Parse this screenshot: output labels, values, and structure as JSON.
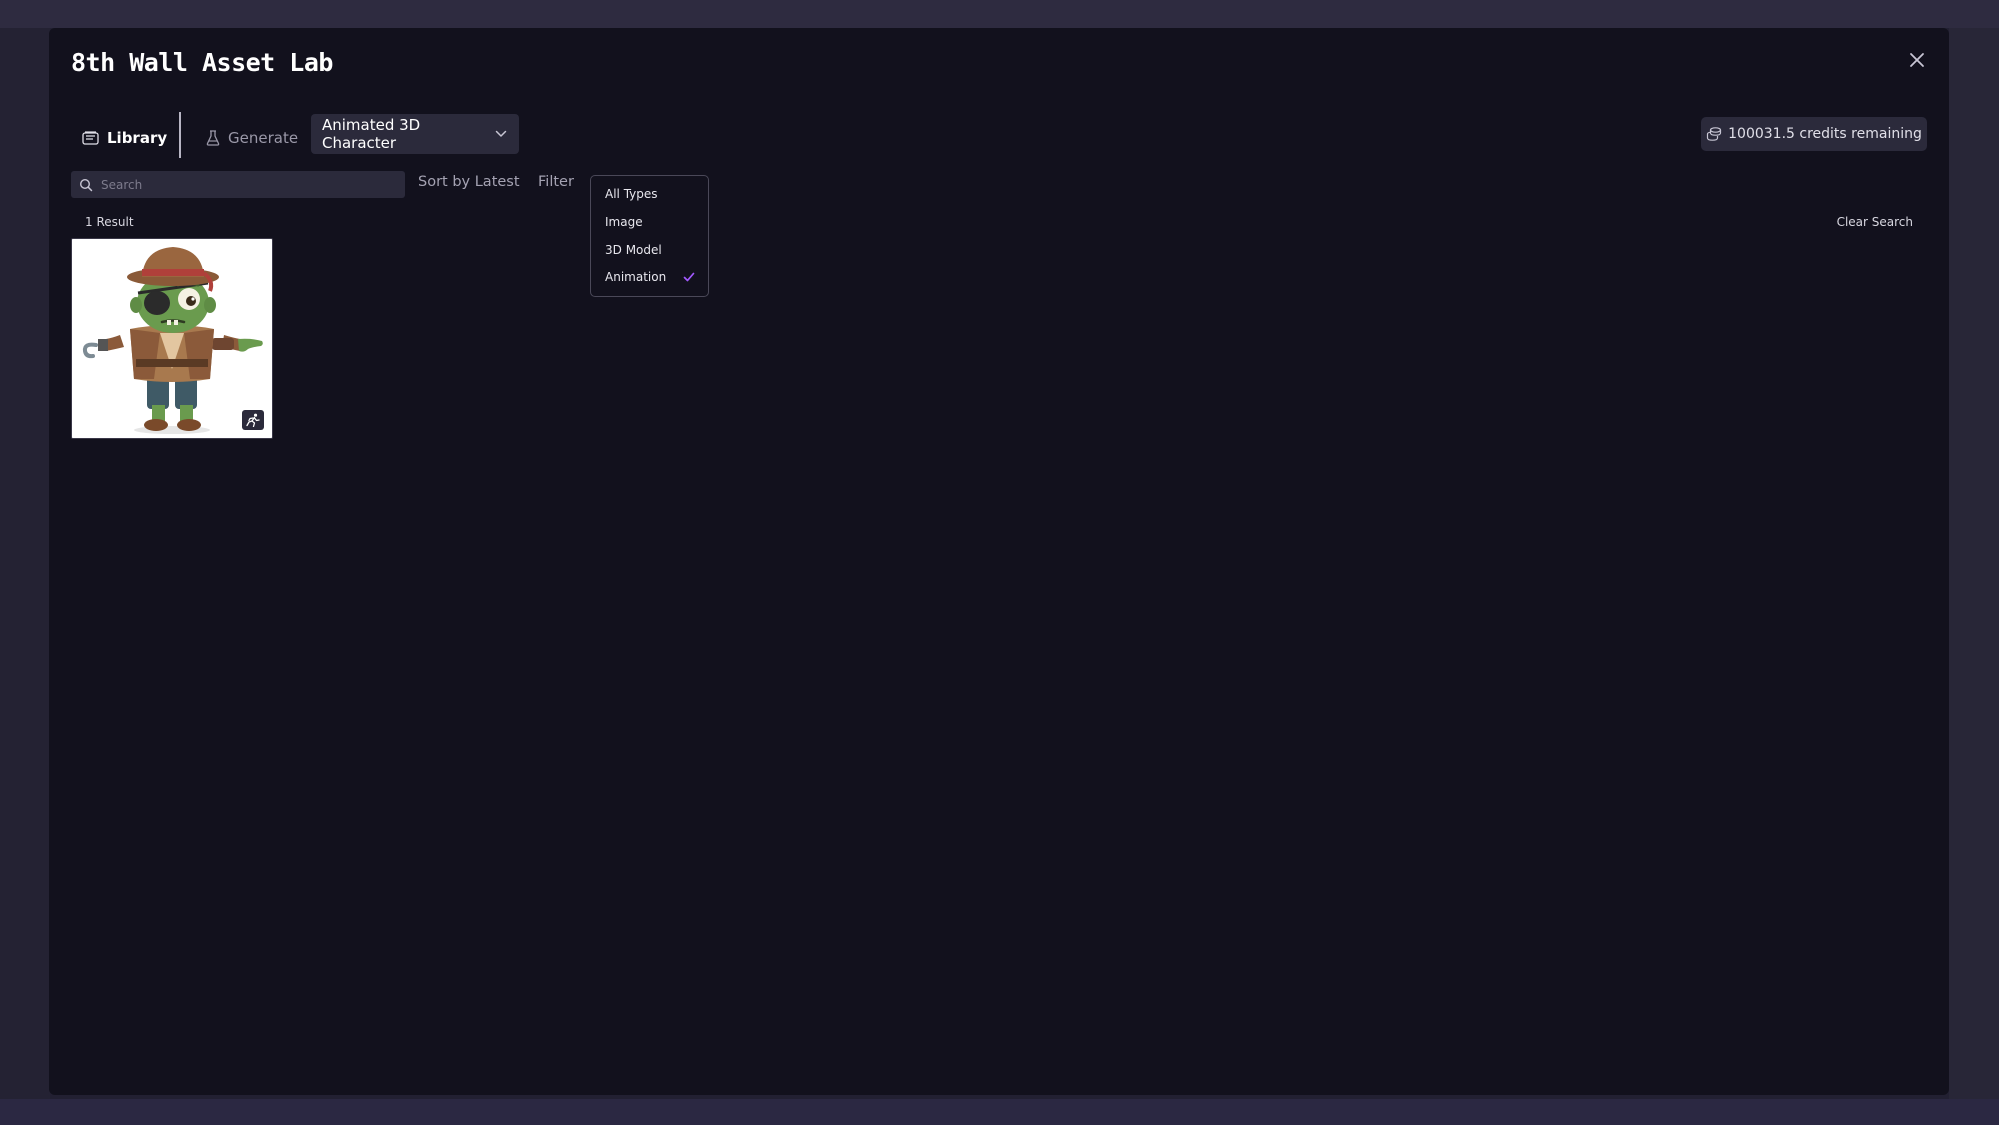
{
  "modal": {
    "title": "8th Wall Asset Lab"
  },
  "tabs": {
    "library": "Library",
    "generate": "Generate"
  },
  "generation_type": {
    "selected": "Animated 3D Character"
  },
  "credits": {
    "label": "100031.5 credits remaining"
  },
  "search": {
    "placeholder": "Search",
    "value": ""
  },
  "toolbar": {
    "sort_label": "Sort by Latest",
    "filter_label": "Filter",
    "clear_search": "Clear Search"
  },
  "filter_menu": {
    "items": [
      {
        "label": "All Types",
        "checked": false
      },
      {
        "label": "Image",
        "checked": false
      },
      {
        "label": "3D Model",
        "checked": false
      },
      {
        "label": "Animation",
        "checked": true
      }
    ],
    "check_color": "#a259ff"
  },
  "results": {
    "count_label": "1 Result",
    "items": [
      {
        "thumbnail": "pirate-zombie-character",
        "type_icon": "animation-running-icon"
      }
    ]
  },
  "colors": {
    "modal_bg": "#12111d",
    "control_bg": "#2b2a3b",
    "accent": "#a259ff"
  }
}
